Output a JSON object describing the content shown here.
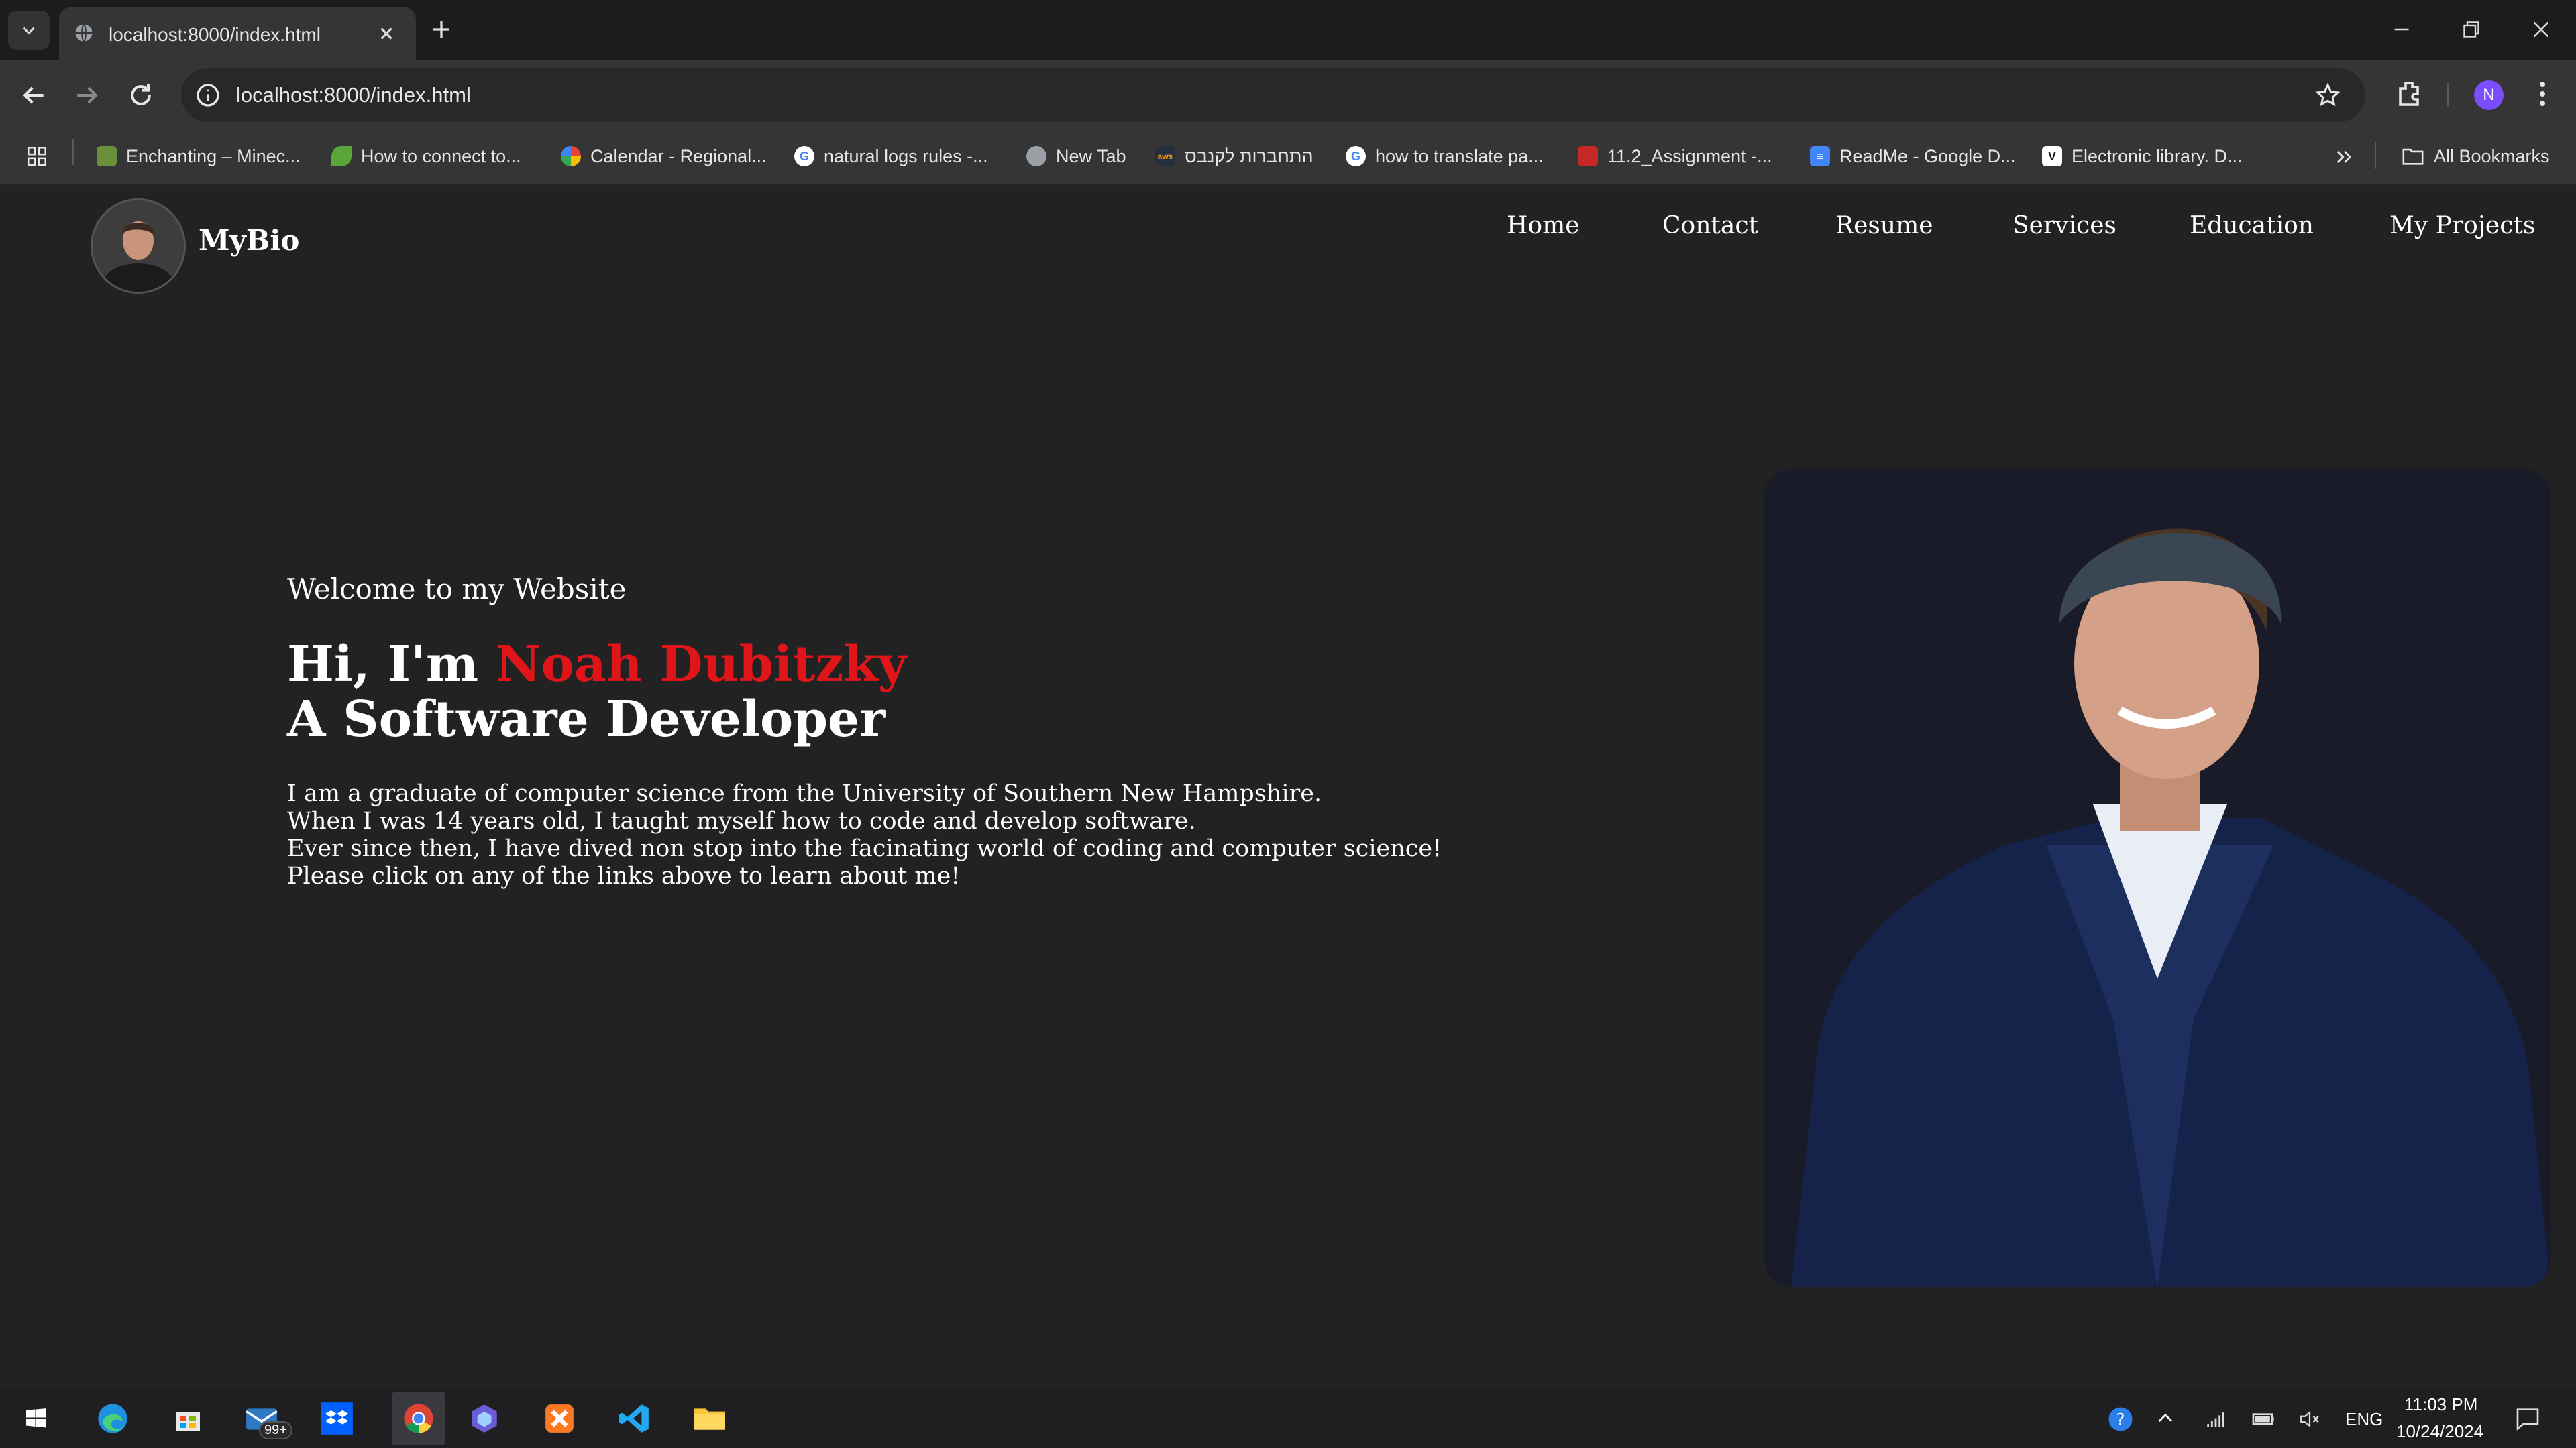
{
  "browser": {
    "tab_title": "localhost:8000/index.html",
    "url": "localhost:8000/index.html",
    "profile_initial": "N",
    "all_bookmarks_label": "All Bookmarks",
    "bookmarks": [
      {
        "label": "Enchanting – Minec...",
        "icon": "minecraft-icon"
      },
      {
        "label": "How to connect to...",
        "icon": "leaf-icon"
      },
      {
        "label": "Calendar - Regional...",
        "icon": "calendar-icon"
      },
      {
        "label": "natural logs rules -...",
        "icon": "google-icon"
      },
      {
        "label": "New Tab",
        "icon": "globe-icon"
      },
      {
        "label": "התחברות לקנבס",
        "icon": "aws-icon"
      },
      {
        "label": "how to translate pa...",
        "icon": "google-icon"
      },
      {
        "label": "11.2_Assignment -...",
        "icon": "assignment-icon"
      },
      {
        "label": "ReadMe - Google D...",
        "icon": "docs-icon"
      },
      {
        "label": "Electronic library. D...",
        "icon": "v-icon"
      }
    ]
  },
  "site": {
    "brand": "MyBio",
    "nav": [
      "Home",
      "Contact",
      "Resume",
      "Services",
      "Education",
      "My Projects"
    ],
    "welcome": "Welcome to my Website",
    "greeting": "Hi, I'm",
    "name": "Noah Dubitzky",
    "role": "A Software Developer",
    "bio": [
      "I am a graduate of computer science from the University of Southern New Hampshire.",
      "When I was 14 years old, I taught myself how to code and develop software.",
      "Ever since then, I have dived non stop into the facinating world of coding and computer science!",
      "Please click on any of the links above to learn about me!"
    ],
    "accent_color": "#e0151a"
  },
  "taskbar": {
    "mail_badge": "99+",
    "language": "ENG",
    "time": "11:03 PM",
    "date": "10/24/2024"
  }
}
